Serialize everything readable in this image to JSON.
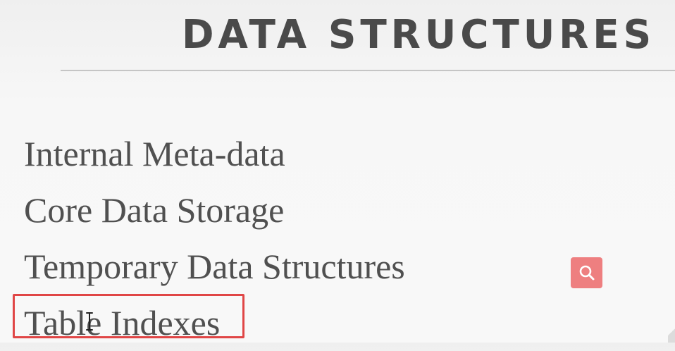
{
  "header": {
    "title": "DATA STRUCTURES"
  },
  "topics": [
    {
      "label": "Internal Meta-data"
    },
    {
      "label": "Core Data Storage"
    },
    {
      "label": "Temporary Data Structures"
    },
    {
      "label": "Table Indexes"
    }
  ],
  "highlight": {
    "color": "#e04646",
    "target": "Table Indexes"
  },
  "search_button": {
    "icon": "search-icon",
    "color": "#ee7f80"
  },
  "colors": {
    "text": "#505050",
    "title": "#4a4a4a",
    "rule": "#c5c5c5"
  }
}
